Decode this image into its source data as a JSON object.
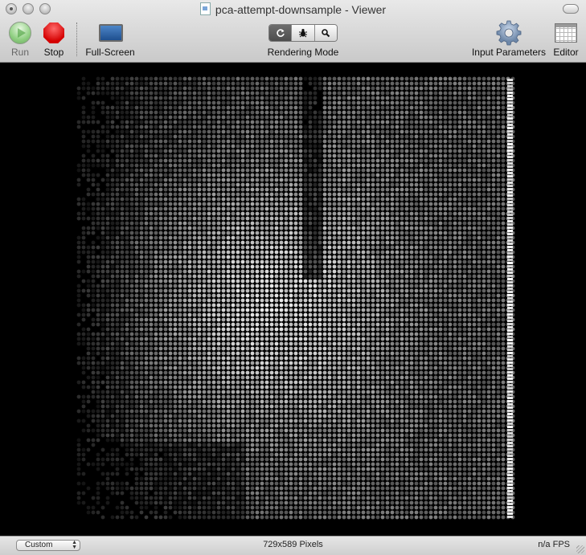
{
  "window": {
    "title": "pca-attempt-downsample - Viewer"
  },
  "toolbar": {
    "run_label": "Run",
    "stop_label": "Stop",
    "fullscreen_label": "Full-Screen",
    "rendering_mode_label": "Rendering Mode",
    "rendering_modes": [
      "refresh-icon",
      "bug-icon",
      "magnifier-icon"
    ],
    "input_parameters_label": "Input Parameters",
    "editor_label": "Editor"
  },
  "viewer": {
    "content": "pixelated grayscale dot-matrix image on black background"
  },
  "statusbar": {
    "size_popup_value": "Custom",
    "dimensions_text": "729x589 Pixels",
    "fps_text": "n/a FPS"
  },
  "colors": {
    "run_green": "#8fcf81",
    "stop_red": "#d40000",
    "viewer_bg": "#000000",
    "selected_segment": "#5c5c5c"
  }
}
